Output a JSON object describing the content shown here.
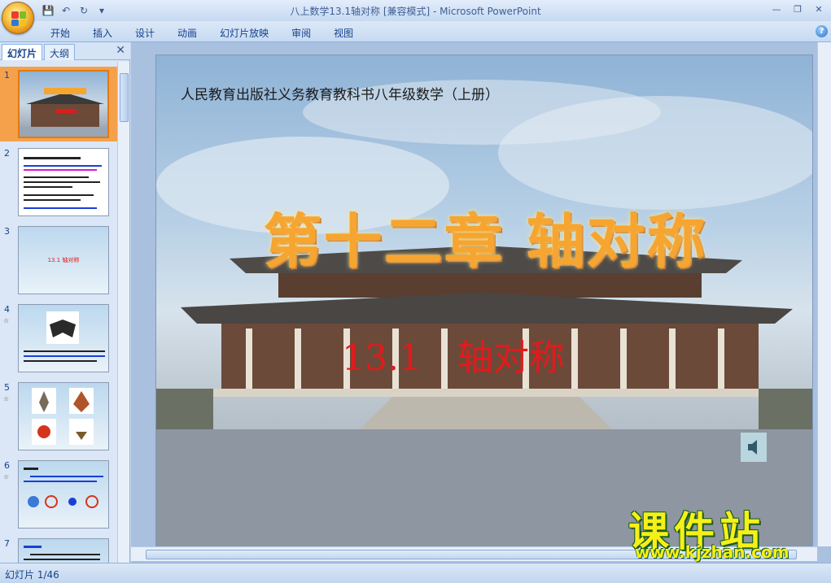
{
  "window": {
    "title": "八上数学13.1轴对称 [兼容模式] - Microsoft PowerPoint"
  },
  "quick_access": [
    {
      "icon": "save-icon",
      "glyph": "💾"
    },
    {
      "icon": "undo-icon",
      "glyph": "↶"
    },
    {
      "icon": "redo-icon",
      "glyph": "↻"
    },
    {
      "icon": "customize-icon",
      "glyph": "▾"
    }
  ],
  "window_controls": {
    "minimize": "—",
    "restore": "❐",
    "close": "✕"
  },
  "ribbon": {
    "tabs": [
      "开始",
      "插入",
      "设计",
      "动画",
      "幻灯片放映",
      "审阅",
      "视图"
    ],
    "help": "?"
  },
  "left_pane": {
    "tabs": [
      "幻灯片",
      "大纲"
    ],
    "close": "✕",
    "thumbnails": [
      {
        "num": "1",
        "has_anim": false,
        "selected": true
      },
      {
        "num": "2",
        "has_anim": false,
        "selected": false
      },
      {
        "num": "3",
        "has_anim": false,
        "selected": false,
        "text": "13.1 轴对称"
      },
      {
        "num": "4",
        "has_anim": true,
        "selected": false
      },
      {
        "num": "5",
        "has_anim": true,
        "selected": false
      },
      {
        "num": "6",
        "has_anim": true,
        "selected": false
      },
      {
        "num": "7",
        "has_anim": false,
        "selected": false
      }
    ],
    "anim_glyph": "☆"
  },
  "slide": {
    "subtitle": "人民教育出版社义务教育教科书八年级数学（上册）",
    "title": "第十二章 轴对称",
    "section": "13.1　轴对称",
    "colors": {
      "title": "#f6a531",
      "section": "#e11b1b"
    }
  },
  "watermark": {
    "main": "课件站",
    "url": "www.kjzhan.com"
  },
  "status": {
    "slide_counter": "幻灯片 1/46"
  }
}
